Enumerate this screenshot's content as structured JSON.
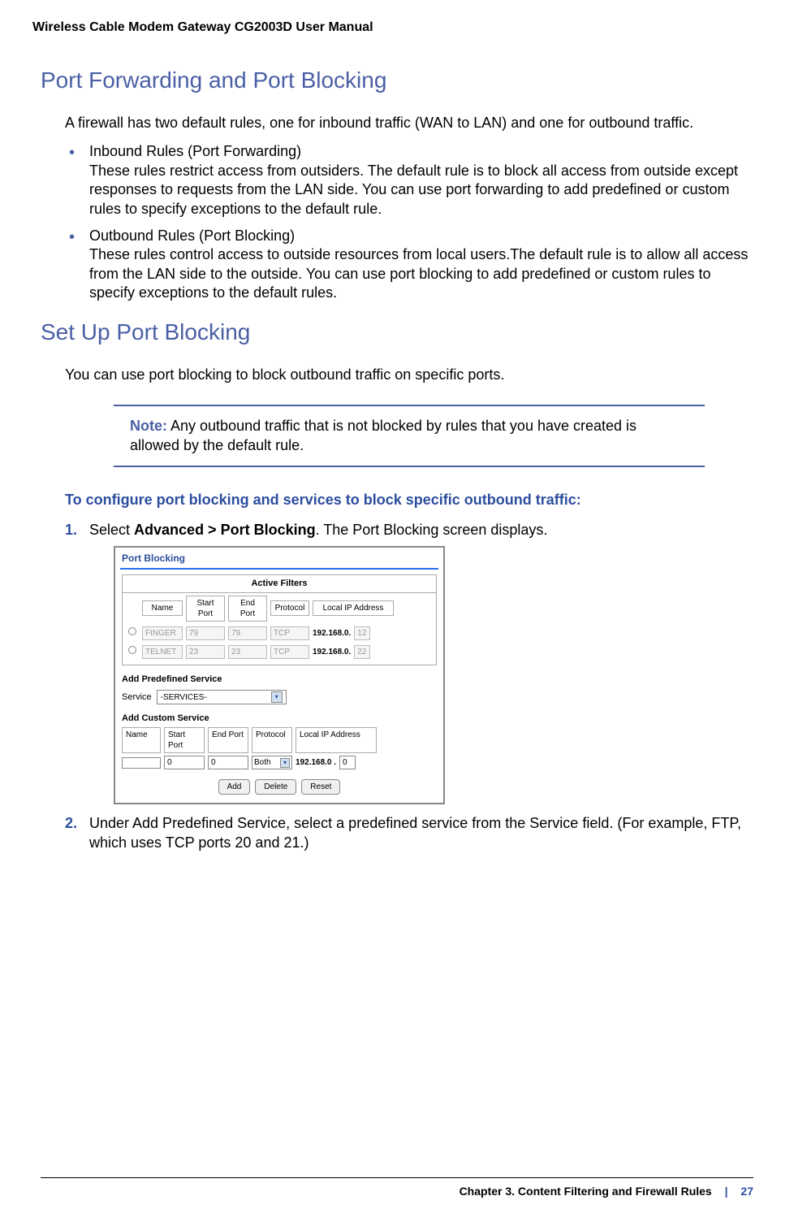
{
  "header": {
    "title": "Wireless Cable Modem Gateway CG2003D User Manual"
  },
  "section1": {
    "heading": "Port Forwarding and Port Blocking",
    "intro": "A firewall has two default rules, one for inbound traffic (WAN to LAN) and one for outbound traffic.",
    "bullets": [
      {
        "title": "Inbound Rules (Port Forwarding)",
        "body": "These rules restrict access from outsiders. The default rule is to block all access from outside except responses to requests from the LAN side. You can use port forwarding to add predefined or custom rules to specify exceptions to the default rule."
      },
      {
        "title": "Outbound Rules (Port Blocking)",
        "body": "These rules control access to outside resources from local users.The default rule is to allow all access from the LAN side to the outside. You can use port blocking to add predefined or custom rules to specify exceptions to the default rules."
      }
    ]
  },
  "section2": {
    "heading": "Set Up Port Blocking",
    "intro": "You can use port blocking to block outbound traffic on specific ports.",
    "note_label": "Note:",
    "note_body": "Any outbound traffic that is not blocked by rules that you have created is allowed by the default rule.",
    "subheading": "To configure port blocking and services to block specific outbound traffic:",
    "steps": [
      {
        "num": "1.",
        "pre": "Select ",
        "bold": "Advanced > Port Blocking",
        "post": ". The Port Blocking screen displays."
      },
      {
        "num": "2.",
        "text": "Under Add Predefined Service, select a predefined service from the Service field. (For example, FTP, which uses TCP ports 20 and 21.)"
      }
    ]
  },
  "screenshot": {
    "title": "Port Blocking",
    "active_filters_label": "Active Filters",
    "headers": {
      "name": "Name",
      "start_port": "Start Port",
      "end_port": "End Port",
      "protocol": "Protocol",
      "local_ip": "Local IP Address"
    },
    "rows": [
      {
        "name": "FINGER",
        "start": "79",
        "end": "79",
        "proto": "TCP",
        "ip_prefix": "192.168.0.",
        "ip_suffix": "12"
      },
      {
        "name": "TELNET",
        "start": "23",
        "end": "23",
        "proto": "TCP",
        "ip_prefix": "192.168.0.",
        "ip_suffix": "22"
      }
    ],
    "add_predefined_label": "Add Predefined Service",
    "service_label": "Service",
    "service_dropdown": "-SERVICES-",
    "add_custom_label": "Add Custom Service",
    "custom": {
      "name": "",
      "start": "0",
      "end": "0",
      "proto": "Both",
      "ip_prefix": "192.168.0 .",
      "ip_suffix": "0"
    },
    "buttons": {
      "add": "Add",
      "delete": "Delete",
      "reset": "Reset"
    }
  },
  "footer": {
    "chapter": "Chapter 3.  Content Filtering and Firewall Rules",
    "pipe": "|",
    "page": "27"
  }
}
